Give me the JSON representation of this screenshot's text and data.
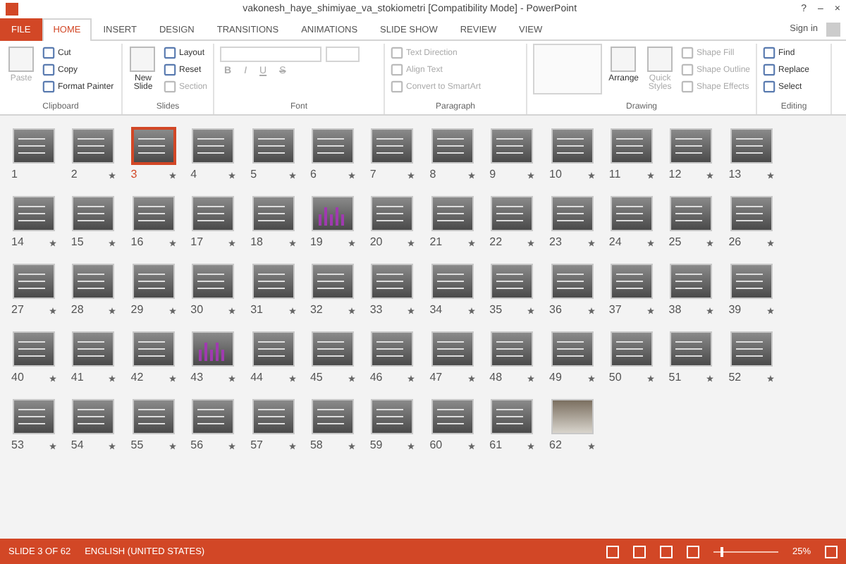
{
  "window": {
    "title": "vakonesh_haye_shimiyae_va_stokiometri [Compatibility Mode] - PowerPoint",
    "controls": [
      "?",
      "–",
      "×"
    ],
    "sign_in": "Sign in"
  },
  "tabs": [
    {
      "label": "FILE",
      "selected": false,
      "kind": "file"
    },
    {
      "label": "HOME",
      "selected": true,
      "kind": "tab"
    },
    {
      "label": "INSERT",
      "selected": false,
      "kind": "tab"
    },
    {
      "label": "DESIGN",
      "selected": false,
      "kind": "tab"
    },
    {
      "label": "TRANSITIONS",
      "selected": false,
      "kind": "tab"
    },
    {
      "label": "ANIMATIONS",
      "selected": false,
      "kind": "tab"
    },
    {
      "label": "SLIDE SHOW",
      "selected": false,
      "kind": "tab"
    },
    {
      "label": "REVIEW",
      "selected": false,
      "kind": "tab"
    },
    {
      "label": "VIEW",
      "selected": false,
      "kind": "tab"
    }
  ],
  "ribbon": [
    {
      "name": "Clipboard",
      "large": [
        {
          "label": "Paste",
          "disabled": true
        }
      ],
      "small": [
        {
          "label": "Cut",
          "disabled": false
        },
        {
          "label": "Copy",
          "disabled": false
        },
        {
          "label": "Format Painter",
          "disabled": false
        }
      ]
    },
    {
      "name": "Slides",
      "large": [
        {
          "label": "New Slide",
          "disabled": false
        }
      ],
      "small": [
        {
          "label": "Layout",
          "disabled": false
        },
        {
          "label": "Reset",
          "disabled": false
        },
        {
          "label": "Section",
          "disabled": true
        }
      ]
    },
    {
      "name": "Font",
      "font_buttons": [
        "B",
        "I",
        "U",
        "S"
      ]
    },
    {
      "name": "Paragraph",
      "small": [
        {
          "label": "Text Direction",
          "disabled": true
        },
        {
          "label": "Align Text",
          "disabled": true
        },
        {
          "label": "Convert to SmartArt",
          "disabled": true
        }
      ]
    },
    {
      "name": "Drawing",
      "large": [
        {
          "label": "Arrange",
          "disabled": false
        },
        {
          "label": "Quick Styles",
          "disabled": true
        }
      ],
      "small": [
        {
          "label": "Shape Fill",
          "disabled": true
        },
        {
          "label": "Shape Outline",
          "disabled": true
        },
        {
          "label": "Shape Effects",
          "disabled": true
        }
      ]
    },
    {
      "name": "Editing",
      "small": [
        {
          "label": "Find",
          "disabled": false
        },
        {
          "label": "Replace",
          "disabled": false
        },
        {
          "label": "Select",
          "disabled": false
        }
      ]
    }
  ],
  "slides": [
    {
      "number": "1",
      "selected": false,
      "transition": false,
      "kind": "text"
    },
    {
      "number": "2",
      "selected": false,
      "transition": true,
      "kind": "text"
    },
    {
      "number": "3",
      "selected": true,
      "transition": true,
      "kind": "text"
    },
    {
      "number": "4",
      "selected": false,
      "transition": true,
      "kind": "text"
    },
    {
      "number": "5",
      "selected": false,
      "transition": true,
      "kind": "text"
    },
    {
      "number": "6",
      "selected": false,
      "transition": true,
      "kind": "text"
    },
    {
      "number": "7",
      "selected": false,
      "transition": true,
      "kind": "text"
    },
    {
      "number": "8",
      "selected": false,
      "transition": true,
      "kind": "text"
    },
    {
      "number": "9",
      "selected": false,
      "transition": true,
      "kind": "text"
    },
    {
      "number": "10",
      "selected": false,
      "transition": true,
      "kind": "text"
    },
    {
      "number": "11",
      "selected": false,
      "transition": true,
      "kind": "text"
    },
    {
      "number": "12",
      "selected": false,
      "transition": true,
      "kind": "text"
    },
    {
      "number": "13",
      "selected": false,
      "transition": true,
      "kind": "text"
    },
    {
      "number": "14",
      "selected": false,
      "transition": true,
      "kind": "text"
    },
    {
      "number": "15",
      "selected": false,
      "transition": true,
      "kind": "text"
    },
    {
      "number": "16",
      "selected": false,
      "transition": true,
      "kind": "text"
    },
    {
      "number": "17",
      "selected": false,
      "transition": true,
      "kind": "text"
    },
    {
      "number": "18",
      "selected": false,
      "transition": true,
      "kind": "text"
    },
    {
      "number": "19",
      "selected": false,
      "transition": true,
      "kind": "graphic"
    },
    {
      "number": "20",
      "selected": false,
      "transition": true,
      "kind": "text"
    },
    {
      "number": "21",
      "selected": false,
      "transition": true,
      "kind": "text"
    },
    {
      "number": "22",
      "selected": false,
      "transition": true,
      "kind": "text"
    },
    {
      "number": "23",
      "selected": false,
      "transition": true,
      "kind": "text"
    },
    {
      "number": "24",
      "selected": false,
      "transition": true,
      "kind": "text"
    },
    {
      "number": "25",
      "selected": false,
      "transition": true,
      "kind": "text"
    },
    {
      "number": "26",
      "selected": false,
      "transition": true,
      "kind": "text"
    },
    {
      "number": "27",
      "selected": false,
      "transition": true,
      "kind": "text"
    },
    {
      "number": "28",
      "selected": false,
      "transition": true,
      "kind": "text"
    },
    {
      "number": "29",
      "selected": false,
      "transition": true,
      "kind": "text"
    },
    {
      "number": "30",
      "selected": false,
      "transition": true,
      "kind": "text"
    },
    {
      "number": "31",
      "selected": false,
      "transition": true,
      "kind": "text"
    },
    {
      "number": "32",
      "selected": false,
      "transition": true,
      "kind": "text"
    },
    {
      "number": "33",
      "selected": false,
      "transition": true,
      "kind": "text"
    },
    {
      "number": "34",
      "selected": false,
      "transition": true,
      "kind": "text"
    },
    {
      "number": "35",
      "selected": false,
      "transition": true,
      "kind": "text"
    },
    {
      "number": "36",
      "selected": false,
      "transition": true,
      "kind": "text"
    },
    {
      "number": "37",
      "selected": false,
      "transition": true,
      "kind": "text"
    },
    {
      "number": "38",
      "selected": false,
      "transition": true,
      "kind": "text"
    },
    {
      "number": "39",
      "selected": false,
      "transition": true,
      "kind": "text"
    },
    {
      "number": "40",
      "selected": false,
      "transition": true,
      "kind": "text"
    },
    {
      "number": "41",
      "selected": false,
      "transition": true,
      "kind": "text"
    },
    {
      "number": "42",
      "selected": false,
      "transition": true,
      "kind": "text"
    },
    {
      "number": "43",
      "selected": false,
      "transition": true,
      "kind": "graphic"
    },
    {
      "number": "44",
      "selected": false,
      "transition": true,
      "kind": "text"
    },
    {
      "number": "45",
      "selected": false,
      "transition": true,
      "kind": "text"
    },
    {
      "number": "46",
      "selected": false,
      "transition": true,
      "kind": "text"
    },
    {
      "number": "47",
      "selected": false,
      "transition": true,
      "kind": "text"
    },
    {
      "number": "48",
      "selected": false,
      "transition": true,
      "kind": "text"
    },
    {
      "number": "49",
      "selected": false,
      "transition": true,
      "kind": "text"
    },
    {
      "number": "50",
      "selected": false,
      "transition": true,
      "kind": "text"
    },
    {
      "number": "51",
      "selected": false,
      "transition": true,
      "kind": "text"
    },
    {
      "number": "52",
      "selected": false,
      "transition": true,
      "kind": "text"
    },
    {
      "number": "53",
      "selected": false,
      "transition": true,
      "kind": "text"
    },
    {
      "number": "54",
      "selected": false,
      "transition": true,
      "kind": "text"
    },
    {
      "number": "55",
      "selected": false,
      "transition": true,
      "kind": "text"
    },
    {
      "number": "56",
      "selected": false,
      "transition": true,
      "kind": "text"
    },
    {
      "number": "57",
      "selected": false,
      "transition": true,
      "kind": "text"
    },
    {
      "number": "58",
      "selected": false,
      "transition": true,
      "kind": "text"
    },
    {
      "number": "59",
      "selected": false,
      "transition": true,
      "kind": "text"
    },
    {
      "number": "60",
      "selected": false,
      "transition": true,
      "kind": "text"
    },
    {
      "number": "61",
      "selected": false,
      "transition": true,
      "kind": "text"
    },
    {
      "number": "62",
      "selected": false,
      "transition": true,
      "kind": "photo"
    }
  ],
  "status_bar": {
    "slide": "SLIDE 3 OF 62",
    "language": "ENGLISH (UNITED STATES)",
    "zoom": {
      "level": 0.12,
      "reading": "25%"
    }
  }
}
